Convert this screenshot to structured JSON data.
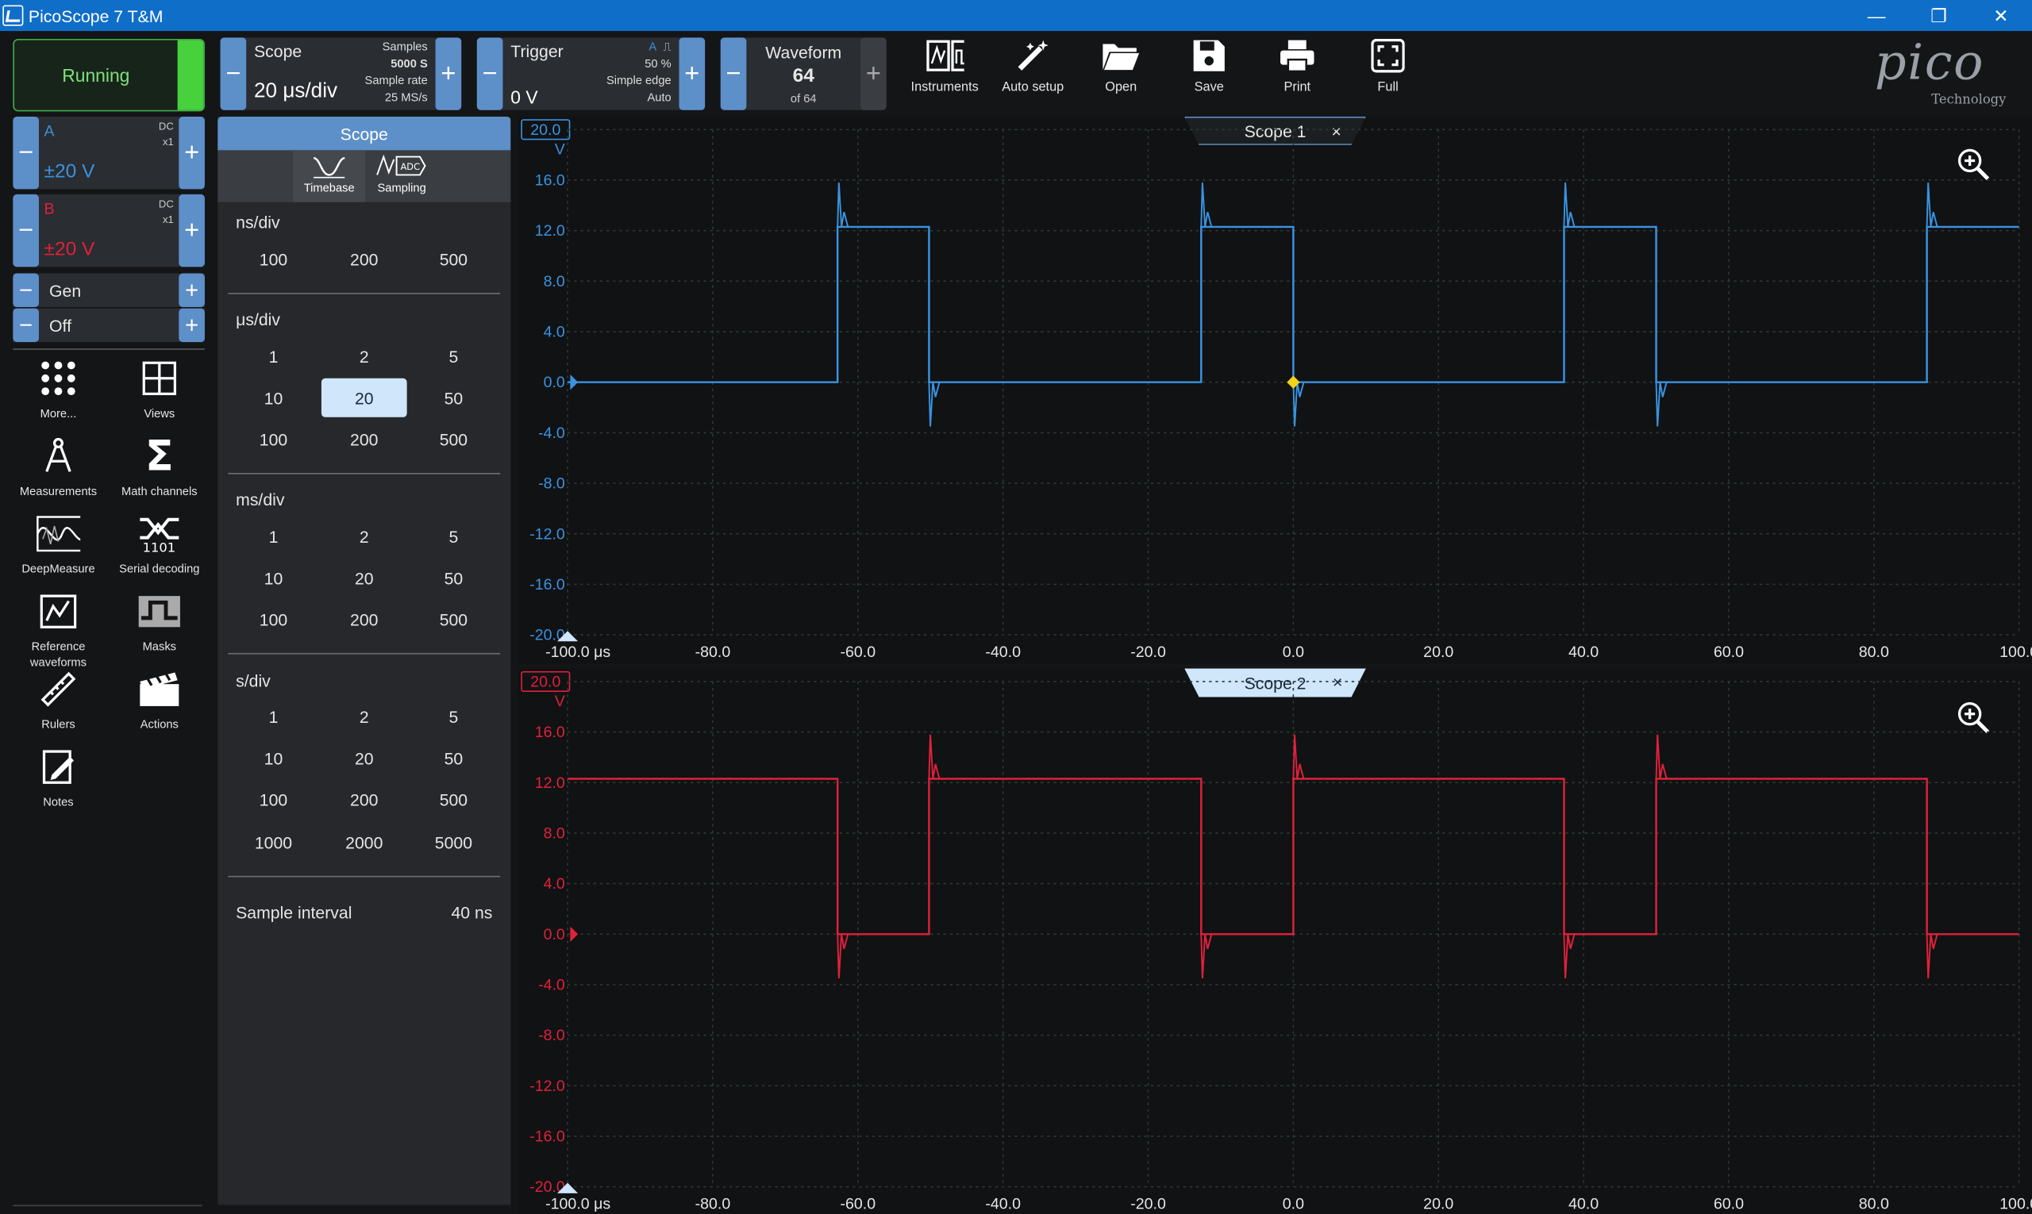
{
  "window": {
    "title": "PicoScope 7 T&M",
    "controls": [
      "—",
      "❐",
      "✕"
    ]
  },
  "toolbar": {
    "run_state": "Running",
    "scope": {
      "label": "Scope",
      "timebase": "20 μs/div",
      "samples_label": "Samples",
      "samples": "5000 S",
      "rate_label": "Sample rate",
      "rate": "25 MS/s"
    },
    "trigger": {
      "label": "Trigger",
      "level": "0 V",
      "channel": "A",
      "edge_glyph": "⎍",
      "percent": "50 %",
      "type": "Simple edge",
      "mode": "Auto"
    },
    "waveform": {
      "label": "Waveform",
      "current": "64",
      "of": "of 64"
    },
    "tools": [
      {
        "label": "Instruments",
        "icon": "instruments-icon"
      },
      {
        "label": "Auto setup",
        "icon": "wand-icon"
      },
      {
        "label": "Open",
        "icon": "folder-icon"
      },
      {
        "label": "Save",
        "icon": "save-icon"
      },
      {
        "label": "Print",
        "icon": "printer-icon"
      },
      {
        "label": "Full",
        "icon": "fullscreen-icon"
      }
    ],
    "logo": {
      "text": "pico",
      "sub": "Technology"
    },
    "minus": "−",
    "plus": "+"
  },
  "channels": [
    {
      "name": "A",
      "coupling": "DC",
      "probe": "x1",
      "range": "±20 V",
      "color": "#3a93e0"
    },
    {
      "name": "B",
      "coupling": "DC",
      "probe": "x1",
      "range": "±20 V",
      "color": "#e0213a"
    }
  ],
  "generator": {
    "label": "Gen",
    "state": "Off"
  },
  "left_tools": [
    {
      "label": "More...",
      "icon": "grid-dots-icon"
    },
    {
      "label": "Views",
      "icon": "views-icon"
    },
    {
      "label": "Measurements",
      "icon": "compass-icon"
    },
    {
      "label": "Math channels",
      "icon": "sigma-icon"
    },
    {
      "label": "DeepMeasure",
      "icon": "deepmeasure-icon"
    },
    {
      "label": "Serial decoding",
      "icon": "serial-decoding-icon"
    },
    {
      "label": "Reference waveforms",
      "icon": "reference-icon"
    },
    {
      "label": "Masks",
      "icon": "masks-icon"
    },
    {
      "label": "Rulers",
      "icon": "ruler-icon"
    },
    {
      "label": "Actions",
      "icon": "clapper-icon"
    },
    {
      "label": "Notes",
      "icon": "notes-icon"
    }
  ],
  "timebase_panel": {
    "title": "Scope",
    "tabs": [
      "Timebase",
      "Sampling"
    ],
    "sections": [
      {
        "unit": "ns/div",
        "values": [
          "100",
          "200",
          "500"
        ]
      },
      {
        "unit": "μs/div",
        "values": [
          "1",
          "2",
          "5",
          "10",
          "20",
          "50",
          "100",
          "200",
          "500"
        ]
      },
      {
        "unit": "ms/div",
        "values": [
          "1",
          "2",
          "5",
          "10",
          "20",
          "50",
          "100",
          "200",
          "500"
        ]
      },
      {
        "unit": "s/div",
        "values": [
          "1",
          "2",
          "5",
          "10",
          "20",
          "50",
          "100",
          "200",
          "500",
          "1000",
          "2000",
          "5000"
        ]
      }
    ],
    "selected": "20",
    "sample_interval_label": "Sample interval",
    "sample_interval": "40 ns"
  },
  "scopes": [
    {
      "tab": "Scope 1",
      "close": "×",
      "unit": "V",
      "color": "#3a93e0",
      "range_box": "20.0"
    },
    {
      "tab": "Scope 2",
      "close": "×",
      "unit": "V",
      "color": "#e0213a",
      "range_box": "20.0"
    }
  ],
  "chart_data": {
    "type": "line",
    "x_unit": "μs",
    "xlim": [
      -100,
      100
    ],
    "ylim": [
      -20,
      20
    ],
    "x_ticks": [
      "-100.0 μs",
      "-80.0",
      "-60.0",
      "-40.0",
      "-20.0",
      "0.0",
      "20.0",
      "40.0",
      "60.0",
      "80.0",
      "100.0"
    ],
    "y_ticks": [
      "20.0",
      "16.0",
      "12.0",
      "8.0",
      "4.0",
      "0.0",
      "-4.0",
      "-8.0",
      "-12.0",
      "-16.0",
      "-20.0"
    ],
    "grid": true,
    "series": [
      {
        "name": "A",
        "x": [
          -100,
          -62.8,
          -62.8,
          -50.2,
          -50.2,
          -12.7,
          -12.7,
          0,
          0,
          37.3,
          37.3,
          50,
          50,
          87.3,
          87.3,
          100
        ],
        "values": [
          0,
          0,
          12.3,
          12.3,
          0,
          0,
          12.3,
          12.3,
          0,
          0,
          12.3,
          12.3,
          0,
          0,
          12.3,
          12.3
        ]
      },
      {
        "name": "B",
        "x": [
          -100,
          -62.8,
          -62.8,
          -50.2,
          -50.2,
          -12.7,
          -12.7,
          0,
          0,
          37.3,
          37.3,
          50,
          50,
          87.3,
          87.3,
          100
        ],
        "values": [
          12.3,
          12.3,
          0,
          0,
          12.3,
          12.3,
          0,
          0,
          12.3,
          12.3,
          0,
          0,
          12.3,
          12.3,
          0,
          0
        ]
      }
    ],
    "trigger_marker": {
      "x": 0,
      "y": 0
    }
  }
}
